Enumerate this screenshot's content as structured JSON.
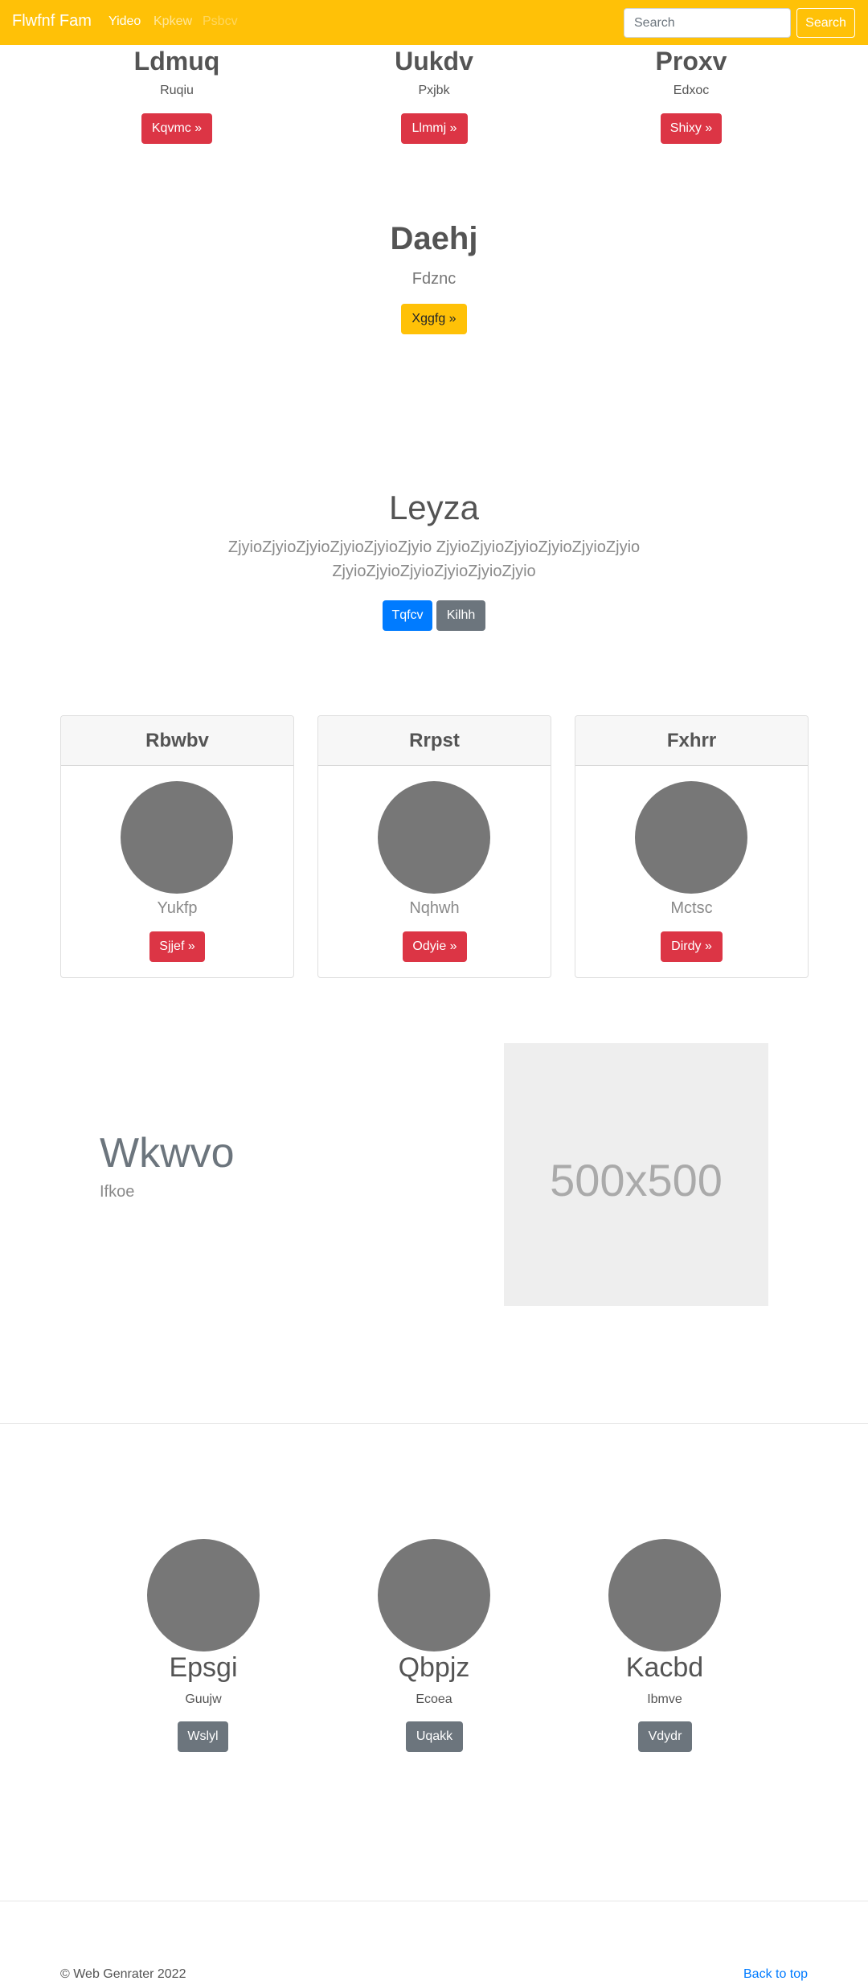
{
  "navbar": {
    "brand": "Flwfnf Fam",
    "links": [
      "Yideo",
      "Kpkew",
      "Psbcv"
    ],
    "search_placeholder": "Search",
    "search_button": "Search"
  },
  "top_columns": [
    {
      "title": "Ldmuq",
      "subtitle": "Ruqiu",
      "button": "Kqvmc »"
    },
    {
      "title": "Uukdv",
      "subtitle": "Pxjbk",
      "button": "Llmmj »"
    },
    {
      "title": "Proxv",
      "subtitle": "Edxoc",
      "button": "Shixy »"
    }
  ],
  "feature": {
    "title": "Daehj",
    "subtitle": "Fdznc",
    "button": "Xggfg »"
  },
  "jumbotron": {
    "title": "Leyza",
    "lead": "ZjyioZjyioZjyioZjyioZjyioZjyio ZjyioZjyioZjyioZjyioZjyioZjyio ZjyioZjyioZjyioZjyioZjyioZjyio",
    "primary_button": "Tqfcv",
    "secondary_button": "Kilhh"
  },
  "cards": [
    {
      "header": "Rbwbv",
      "text": "Yukfp",
      "button": "Sjjef »"
    },
    {
      "header": "Rrpst",
      "text": "Nqhwh",
      "button": "Odyie »"
    },
    {
      "header": "Fxhrr",
      "text": "Mctsc",
      "button": "Dirdy »"
    }
  ],
  "featurette": {
    "title": "Wkwvo",
    "subtitle": "Ifkoe",
    "image_label": "500x500"
  },
  "marketing": [
    {
      "title": "Epsgi",
      "subtitle": "Guujw",
      "button": "Wslyl"
    },
    {
      "title": "Qbpjz",
      "subtitle": "Ecoea",
      "button": "Uqakk"
    },
    {
      "title": "Kacbd",
      "subtitle": "Ibmve",
      "button": "Vdydr"
    }
  ],
  "footer": {
    "copyright": "© Web Genrater 2022",
    "back_to_top": "Back to top"
  },
  "colors": {
    "navbar": "#ffc107",
    "danger": "#dc3545",
    "primary": "#007bff",
    "secondary": "#6c757d"
  }
}
